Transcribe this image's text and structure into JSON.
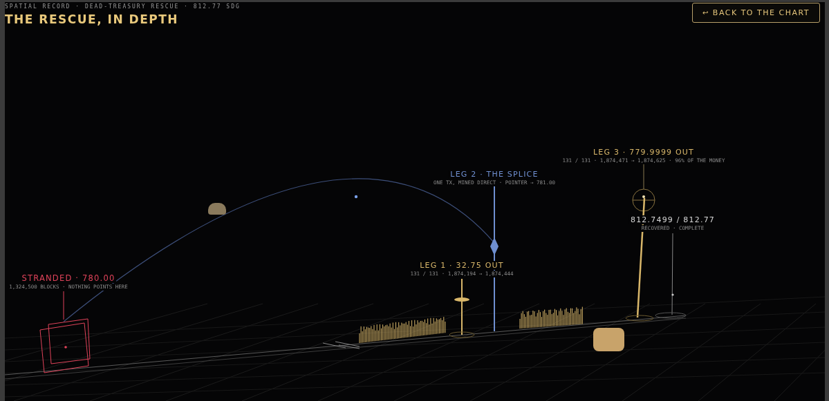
{
  "header": {
    "kicker": "SPATIAL RECORD · DEAD-TREASURY RESCUE · 812.77 SDG",
    "title": "THE RESCUE, IN DEPTH"
  },
  "back_button": {
    "icon": "↩",
    "label": "BACK TO THE CHART"
  },
  "labels": [
    {
      "kind": "stranded",
      "title": "STRANDED · 780.00",
      "subtitle": "1,324,500 BLOCKS · NOTHING POINTS HERE",
      "color": "#e0435a"
    },
    {
      "kind": "leg",
      "title": "LEG 1 · 32.75 OUT",
      "subtitle": "131 / 131 · 1,874,194 → 1,874,444",
      "color": "#d9b76a"
    },
    {
      "kind": "leg",
      "title": "LEG 2 · THE SPLICE",
      "subtitle": "ONE TX, MINED DIRECT · POINTER → 781.00",
      "color": "#6f8fd0"
    },
    {
      "kind": "leg",
      "title": "LEG 3 · 779.9999 OUT",
      "subtitle": "131 / 131 · 1,874,471 → 1,874,625 · 96% OF THE MONEY",
      "color": "#d9b76a"
    },
    {
      "kind": "total",
      "title": "812.7499 / 812.77",
      "subtitle": "RECOVERED · COMPLETE",
      "color": "#d8d8d8"
    }
  ]
}
